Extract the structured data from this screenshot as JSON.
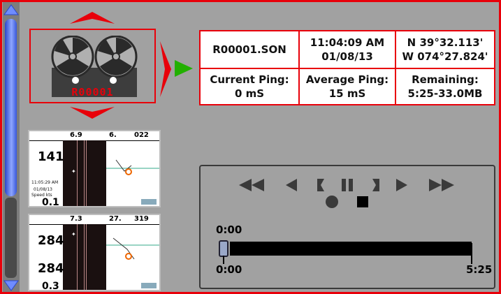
{
  "recording": {
    "reel_label": "R00001"
  },
  "info": {
    "file": "R00001.SON",
    "time": "11:04:09 AM",
    "date": "01/08/13",
    "lat": "N 39°32.113'",
    "lon": "W 074°27.824'",
    "current_ping_label": "Current Ping:",
    "current_ping_value": "0 mS",
    "average_ping_label": "Average Ping:",
    "average_ping_value": "15 mS",
    "remaining_label": "Remaining:",
    "remaining_value": "5:25-33.0MB"
  },
  "thumbnails": [
    {
      "top_values": [
        "6.9",
        "6.",
        "022"
      ],
      "big_number": "141",
      "time": "11:05:29 AM",
      "date": "01/08/13",
      "speed_label": "Speed",
      "speed_unit": "kts",
      "speed": "0.1"
    },
    {
      "top_values": [
        "7.3",
        "27.",
        "319"
      ],
      "big_number": "284",
      "big_number_2": "284",
      "speed": "0.3"
    }
  ],
  "playback": {
    "position_label": "0:00",
    "start_label": "0:00",
    "end_label": "5:25",
    "progress": 0.0
  },
  "colors": {
    "accent_red": "#e8000a",
    "play_green": "#22b000",
    "panel_gray": "#a1a1a1"
  }
}
